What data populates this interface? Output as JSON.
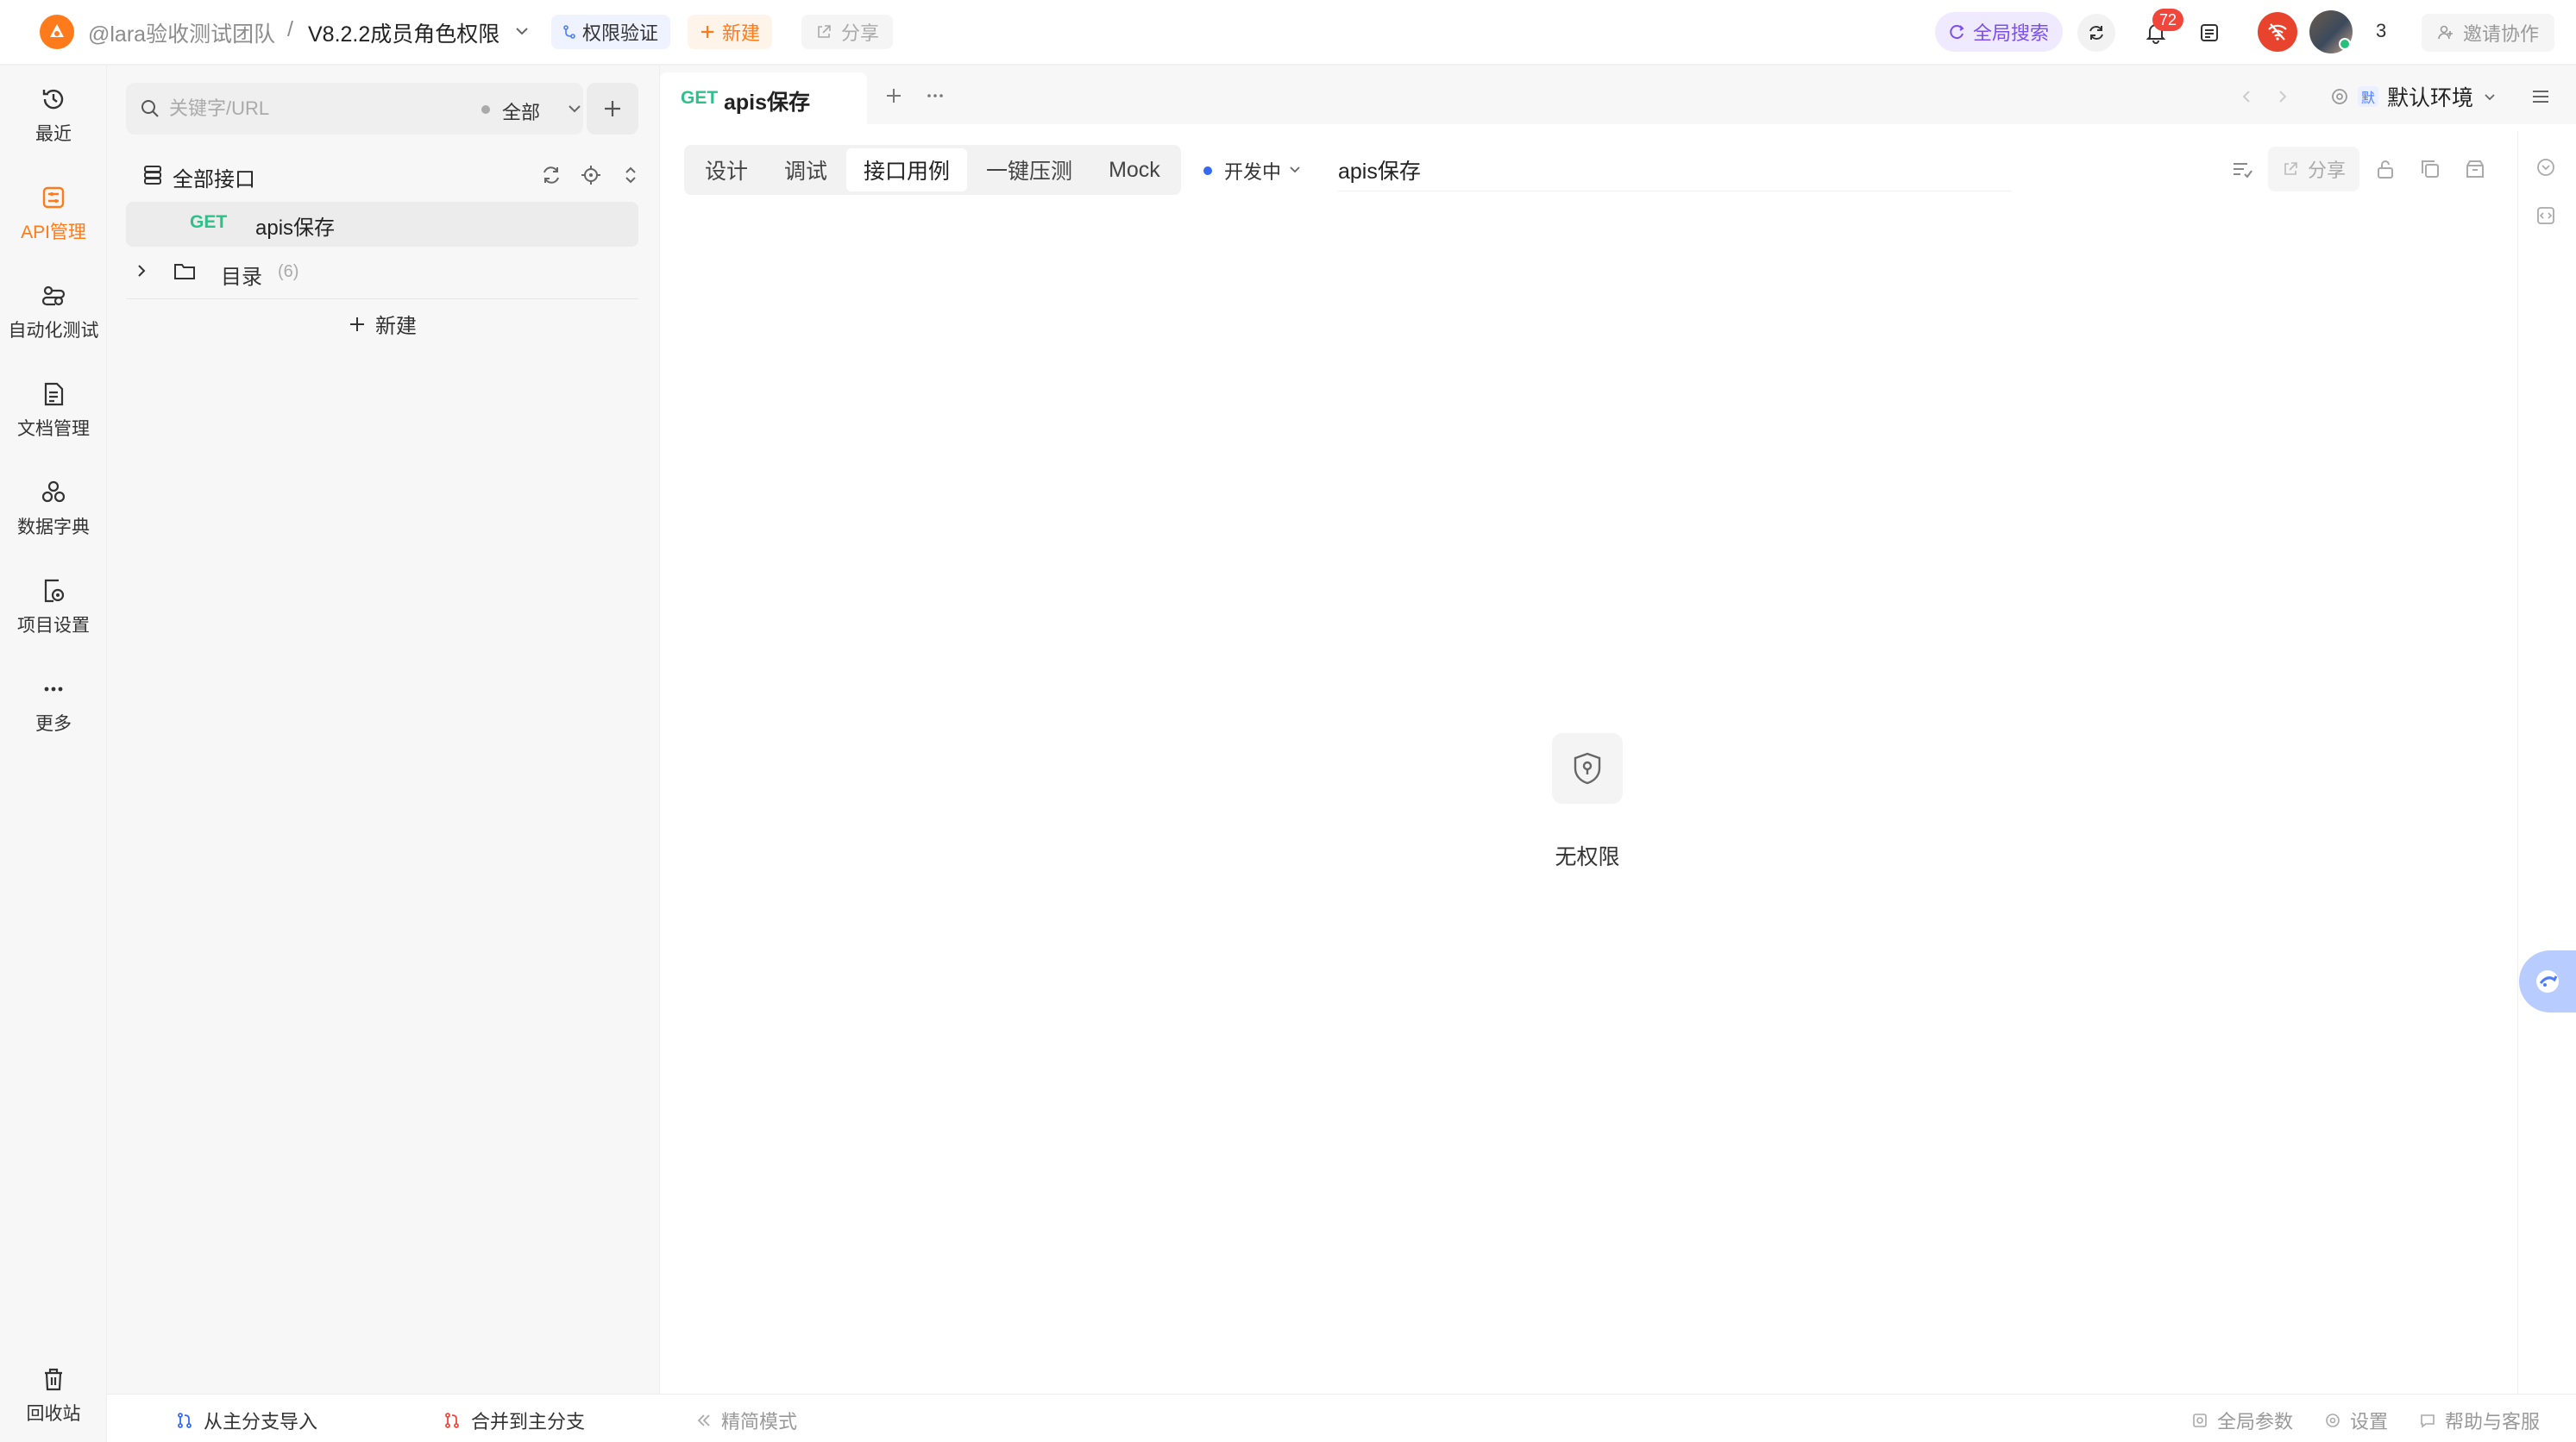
{
  "topbar": {
    "team": "@lara验收测试团队",
    "separator": "/",
    "project": "V8.2.2成员角色权限",
    "perm_tag": "权限验证",
    "new_label": "新建",
    "share_label": "分享",
    "global_search": "全局搜索",
    "notification_count": "72",
    "member_count": "3",
    "invite_label": "邀请协作"
  },
  "rail": {
    "items": [
      {
        "label": "最近",
        "icon": "history-icon"
      },
      {
        "label": "API管理",
        "icon": "api-icon"
      },
      {
        "label": "自动化测试",
        "icon": "automation-icon"
      },
      {
        "label": "文档管理",
        "icon": "document-icon"
      },
      {
        "label": "数据字典",
        "icon": "dictionary-icon"
      },
      {
        "label": "项目设置",
        "icon": "project-settings-icon"
      },
      {
        "label": "更多",
        "icon": "more-icon"
      }
    ],
    "trash_label": "回收站"
  },
  "tree": {
    "search_placeholder": "关键字/URL",
    "filter_label": "全部",
    "root_label": "全部接口",
    "items": [
      {
        "method": "GET",
        "label": "apis保存"
      }
    ],
    "folder": {
      "label": "目录",
      "count": "(6)"
    },
    "new_label": "新建",
    "bottom": {
      "import_label": "从主分支导入",
      "merge_label": "合并到主分支"
    }
  },
  "main": {
    "tab": {
      "method": "GET",
      "title": "apis保存"
    },
    "environment": {
      "badge": "默",
      "label": "默认环境"
    },
    "subtabs": [
      "设计",
      "调试",
      "接口用例",
      "一键压测",
      "Mock"
    ],
    "active_subtab": "接口用例",
    "status_label": "开发中",
    "api_name": "apis保存",
    "share_label": "分享",
    "empty_label": "无权限"
  },
  "statusbar": {
    "simple_mode": "精简模式",
    "global_params": "全局参数",
    "settings": "设置",
    "help": "帮助与客服"
  },
  "colors": {
    "accent": "#ff7a1a",
    "get_method": "#2ec08a",
    "status_dot": "#3569f2",
    "badge": "#f0463c",
    "search_purple": "#7b4ef0"
  }
}
